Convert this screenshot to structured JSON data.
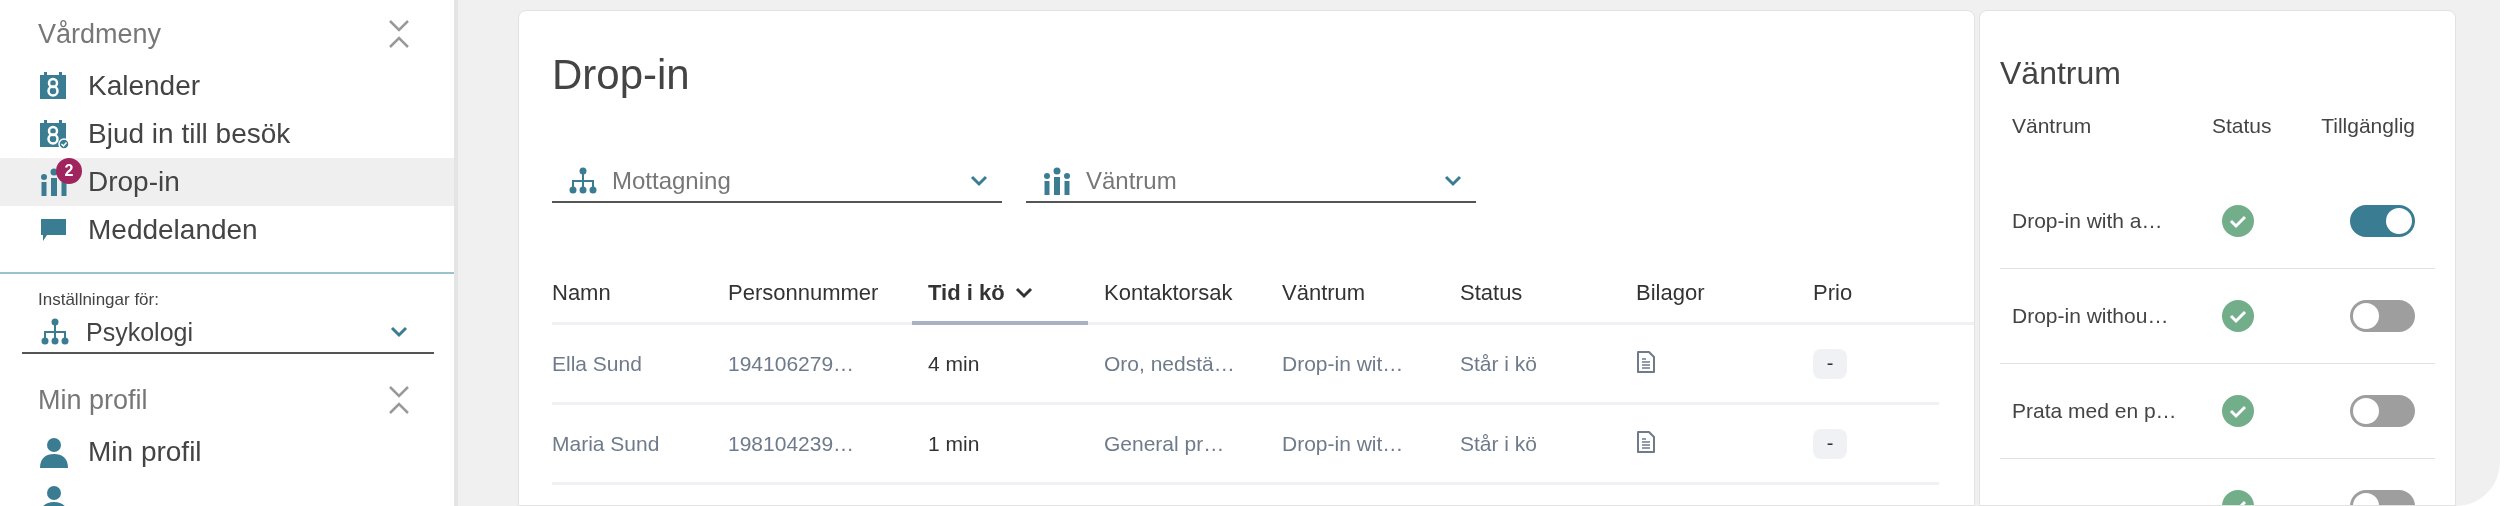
{
  "sidebar": {
    "sections": [
      {
        "title": "Vårdmeny",
        "items": [
          {
            "label": "Kalender",
            "selected": false
          },
          {
            "label": "Bjud in till besök",
            "selected": false
          },
          {
            "label": "Drop-in",
            "selected": true,
            "badge": "2"
          },
          {
            "label": "Meddelanden",
            "selected": false
          }
        ]
      },
      {
        "title": "Min profil",
        "items": [
          {
            "label": "Min profil",
            "selected": false
          },
          {
            "selected": false
          }
        ]
      }
    ],
    "settings": {
      "label": "Inställningar för:",
      "value": "Psykologi"
    }
  },
  "main": {
    "title": "Drop-in",
    "filters": [
      {
        "placeholder": "Mottagning"
      },
      {
        "placeholder": "Väntrum"
      }
    ],
    "table": {
      "columns": [
        {
          "label": "Namn",
          "sorted": false
        },
        {
          "label": "Personnummer",
          "sorted": false
        },
        {
          "label": "Tid i kö",
          "sorted": true
        },
        {
          "label": "Kontaktorsak",
          "sorted": false
        },
        {
          "label": "Väntrum",
          "sorted": false
        },
        {
          "label": "Status",
          "sorted": false
        },
        {
          "label": "Bilagor",
          "sorted": false
        },
        {
          "label": "Prio",
          "sorted": false
        }
      ],
      "rows": [
        {
          "name": "Ella Sund",
          "personnummer": "194106279…",
          "time": "4 min",
          "reason": "Oro, nedstä…",
          "room": "Drop-in wit…",
          "status": "Står i kö",
          "prio": "-"
        },
        {
          "name": "Maria Sund",
          "personnummer": "198104239…",
          "time": "1 min",
          "reason": "General pr…",
          "room": "Drop-in wit…",
          "status": "Står i kö",
          "prio": "-"
        }
      ]
    }
  },
  "waiting_rooms": {
    "title": "Väntrum",
    "columns": [
      "Väntrum",
      "Status",
      "Tillgänglig"
    ],
    "rows": [
      {
        "name": "Drop-in with a…",
        "available": true
      },
      {
        "name": "Drop-in withou…",
        "available": false
      },
      {
        "name": "Prata med en p…",
        "available": false
      },
      {
        "available": false
      }
    ]
  }
}
